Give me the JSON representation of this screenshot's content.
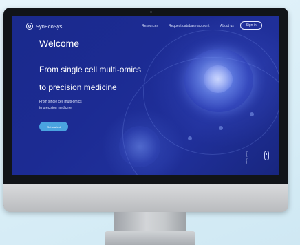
{
  "brand": {
    "name": "SynEcoSys"
  },
  "nav": {
    "items": [
      "Resources",
      "Request database account",
      "About us"
    ],
    "signin_label": "Sign in"
  },
  "hero": {
    "welcome": "Welcome",
    "headline_line1": "From single cell multi-omics",
    "headline_line2": "to precision medicine",
    "sub_line1": "From single cell multi-omics",
    "sub_line2": "to precision medicine",
    "cta_label": "Get started"
  },
  "scroll": {
    "label": "Scroll Down"
  },
  "colors": {
    "screen_bg": "#1c2b93",
    "cta": "#4aa3e0",
    "text": "#ffffff"
  }
}
